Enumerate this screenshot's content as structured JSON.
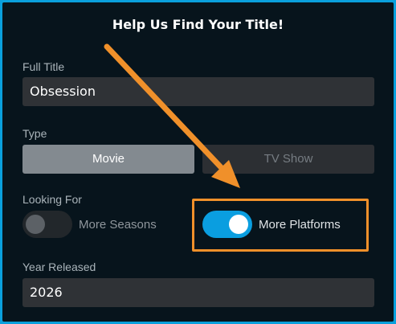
{
  "form": {
    "title": "Help Us Find Your Title!",
    "full_title": {
      "label": "Full Title",
      "value": "Obsession"
    },
    "type": {
      "label": "Type",
      "options": [
        "Movie",
        "TV Show"
      ],
      "selected": "Movie"
    },
    "looking_for": {
      "label": "Looking For",
      "options": [
        {
          "label": "More Seasons",
          "on": false
        },
        {
          "label": "More Platforms",
          "on": true
        }
      ]
    },
    "year_released": {
      "label": "Year Released",
      "value": "2026"
    }
  },
  "colors": {
    "accent": "#0a9ee0",
    "annotation": "#f0902a",
    "background": "#07141c",
    "field": "#2f3236"
  },
  "icons": {
    "annotation_arrow": "arrow-down-right-icon"
  }
}
